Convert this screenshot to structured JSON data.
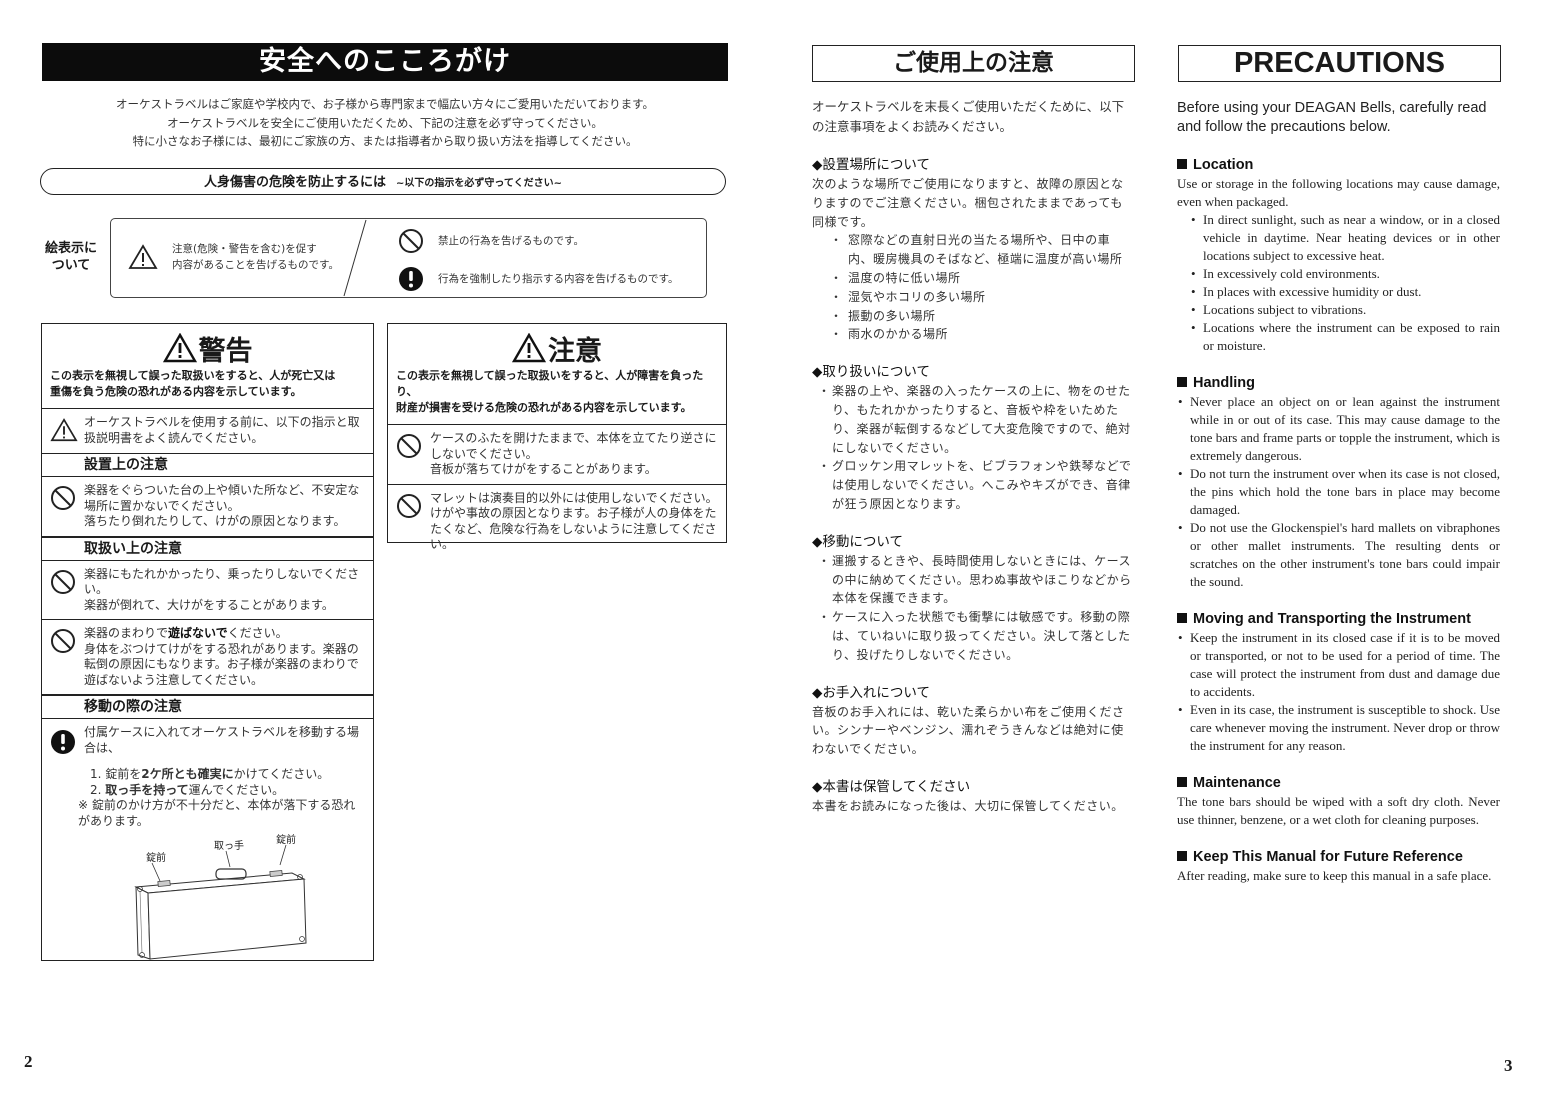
{
  "left_page": {
    "banner_title": "安全へのこころがけ",
    "intro_lines": [
      "オーケストラベルはご家庭や学校内で、お子様から専門家まで幅広い方々にご愛用いただいております。",
      "オーケストラベルを安全にご使用いただくため、下記の注意を必ず守ってください。",
      "特に小さなお子様には、最初にご家族の方、または指導者から取り扱い方法を指導してください。"
    ],
    "injury_banner": {
      "main": "人身傷害の危険を防止するには",
      "sub": "~以下の指示を必ず守ってください~"
    },
    "legend": {
      "label_line1": "絵表示に",
      "label_line2": "ついて",
      "caution_line1": "注意(危険・警告を含む)を促す",
      "caution_line2": "内容があることを告げるものです。",
      "prohibited": "禁止の行為を告げるものです。",
      "mandatory": "行為を強制したり指示する内容を告げるものです。"
    },
    "warning_box": {
      "title": "警告",
      "desc_line1": "この表示を無視して誤った取扱いをすると、人が死亡又は",
      "desc_line2": "重傷を負う危険の恐れがある内容を示しています。",
      "intro_item": "オーケストラベルを使用する前に、以下の指示と取扱説明書をよく読んでください。",
      "sec_installation": "設置上の注意",
      "installation_item_1": "楽器をぐらついた台の上や傾いた所など、不安定な場所に置かないでください。",
      "installation_item_2": "落ちたり倒れたりして、けがの原因となります。",
      "sec_handling": "取扱い上の注意",
      "handling_1_a": "楽器にもたれかかったり、乗ったりしないでください。",
      "handling_1_b": "楽器が倒れて、大けがをすることがあります。",
      "handling_2_pre": "楽器のまわりで",
      "handling_2_bold": "遊ばないで",
      "handling_2_post": "ください。",
      "handling_2_b": "身体をぶつけてけがをする恐れがあります。楽器の転倒の原因にもなります。お子様が楽器のまわりで遊ばないよう注意してください。",
      "sec_moving": "移動の際の注意",
      "moving_intro": "付属ケースに入れてオーケストラベルを移動する場合は、",
      "step1_pre": "1. 錠前を",
      "step1_bold": "2ケ所とも確実に",
      "step1_post": "かけてください。",
      "step2_pre": "2. ",
      "step2_bold": "取っ手を持って",
      "step2_post": "運んでください。",
      "note": "※ 錠前のかけ方が不十分だと、本体が落下する恐れがあります。",
      "illus_handle": "取っ手",
      "illus_lock_left": "錠前",
      "illus_lock_right": "錠前"
    },
    "caution_box": {
      "title": "注意",
      "desc_line1": "この表示を無視して誤った取扱いをすると、人が障害を負ったり、",
      "desc_line2": "財産が損害を受ける危険の恐れがある内容を示しています。",
      "item1_a": "ケースのふたを開けたままで、本体を立てたり逆さにしないでください。",
      "item1_b": "音板が落ちてけがをすることがあります。",
      "item2": "マレットは演奏目的以外には使用しないでください。けがや事故の原因となります。お子様が人の身体をたたくなど、危険な行為をしないように注意してください。"
    },
    "page_number": "2"
  },
  "jp_page": {
    "title": "ご使用上の注意",
    "lead": "オーケストラベルを末長くご使用いただくために、以下の注意事項をよくお読みください。",
    "sections": [
      {
        "heading": "◆設置場所について",
        "text": "次のような場所でご使用になりますと、故障の原因となりますのでご注意ください。梱包されたままであっても同様です。",
        "items": [
          "窓際などの直射日光の当たる場所や、日中の車内、暖房機具のそばなど、極端に温度が高い場所",
          "温度の特に低い場所",
          "湿気やホコリの多い場所",
          "振動の多い場所",
          "雨水のかかる場所"
        ]
      },
      {
        "heading": "◆取り扱いについて",
        "items": [
          "楽器の上や、楽器の入ったケースの上に、物をのせたり、もたれかかったりすると、音板や枠をいためたり、楽器が転倒するなどして大変危険ですので、絶対にしないでください。",
          "グロッケン用マレットを、ビブラフォンや鉄琴などでは使用しないでください。へこみやキズができ、音律が狂う原因となります。"
        ]
      },
      {
        "heading": "◆移動について",
        "items": [
          "運搬するときや、長時間使用しないときには、ケースの中に納めてください。思わぬ事故やほこりなどから本体を保護できます。",
          "ケースに入った状態でも衝撃には敏感です。移動の際は、ていねいに取り扱ってください。決して落としたり、投げたりしないでください。"
        ]
      },
      {
        "heading": "◆お手入れについて",
        "text": "音板のお手入れには、乾いた柔らかい布をご使用ください。シンナーやベンジン、濡れぞうきんなどは絶対に使わないでください。"
      },
      {
        "heading": "◆本書は保管してください",
        "text": "本書をお読みになった後は、大切に保管してください。"
      }
    ]
  },
  "en_page": {
    "title": "PRECAUTIONS",
    "lead": "Before using your DEAGAN Bells, carefully read and follow the precautions below.",
    "sections": [
      {
        "heading": "Location",
        "text": "Use or storage in the following locations may cause damage, even when packaged.",
        "items": [
          "In direct sunlight, such as near a window, or in a closed vehicle in daytime. Near heating devices or in other locations subject to excessive heat.",
          "In excessively cold environments.",
          "In places with excessive humidity or dust.",
          "Locations subject to vibrations.",
          "Locations where the instrument can be exposed to rain or moisture."
        ]
      },
      {
        "heading": "Handling",
        "items": [
          "Never place an object on or lean against the instrument while in or out of its case. This may cause damage to the tone bars and frame parts or topple the instrument, which is extremely dangerous.",
          "Do not turn the instrument over when its case is not closed, the pins which hold the tone bars in place may become damaged.",
          "Do not use the Glockenspiel's hard mallets on vibraphones or other mallet instruments. The resulting dents or scratches on the other instrument's tone bars could impair the sound."
        ]
      },
      {
        "heading": "Moving and Transporting the Instrument",
        "items": [
          "Keep the instrument in its closed case if it is to be moved or transported, or not to be used for a period of time. The case will protect the instrument from dust and damage due to accidents.",
          "Even in its case, the instrument is susceptible to shock. Use care whenever moving the instrument. Never drop or throw the instrument for any reason."
        ]
      },
      {
        "heading": "Maintenance",
        "text": "The tone bars should be wiped with a soft dry cloth. Never use thinner, benzene, or a wet cloth for cleaning purposes."
      },
      {
        "heading": "Keep This Manual for Future Reference",
        "text": "After reading, make sure to keep this manual in a safe place."
      }
    ],
    "page_number": "3"
  },
  "icons": {
    "caution": "warning-triangle-icon",
    "prohibited": "prohibition-circle-icon",
    "mandatory": "exclamation-circle-icon"
  }
}
